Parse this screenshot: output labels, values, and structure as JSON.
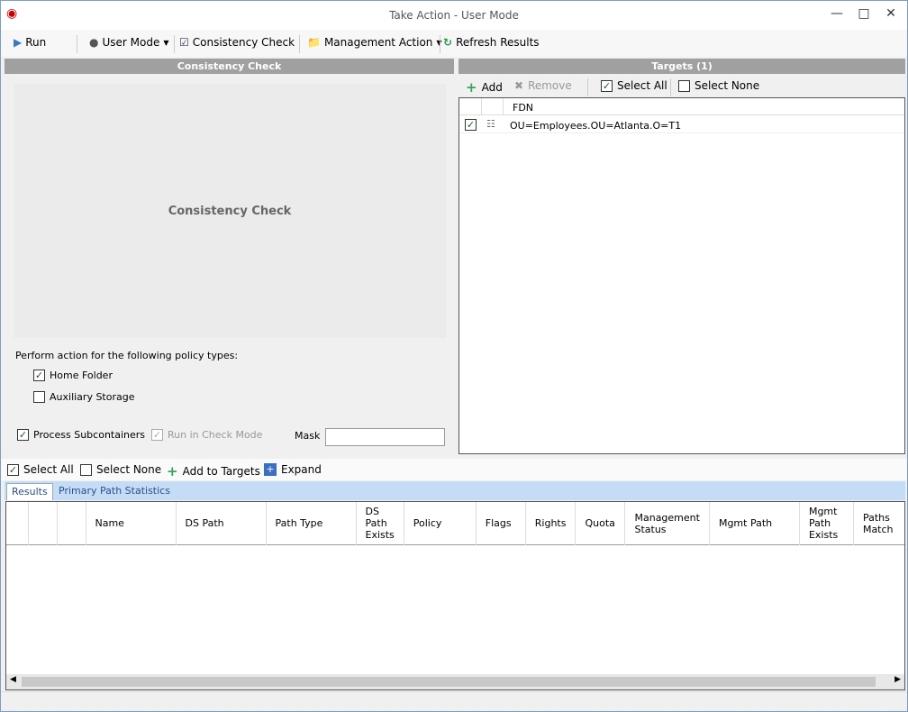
{
  "window": {
    "title": "Take Action - User Mode"
  },
  "toolbar": {
    "run": "Run",
    "user_mode": "User Mode",
    "consistency_check": "Consistency Check",
    "management_action": "Management Action",
    "refresh_results": "Refresh Results"
  },
  "left_panel": {
    "header": "Consistency Check",
    "preview_label": "Consistency Check",
    "policy_prompt": "Perform action for the following policy types:",
    "home_folder": "Home Folder",
    "auxiliary_storage": "Auxiliary Storage",
    "process_subcontainers": "Process Subcontainers",
    "run_in_check_mode": "Run in Check Mode",
    "mask_label": "Mask",
    "mask_value": ""
  },
  "targets": {
    "header": "Targets  (1)",
    "add": "Add",
    "remove": "Remove",
    "select_all": "Select All",
    "select_none": "Select None",
    "column": "FDN",
    "rows": [
      {
        "fdn": "OU=Employees.OU=Atlanta.O=T1",
        "checked": true
      }
    ]
  },
  "results_toolbar": {
    "select_all": "Select All",
    "select_none": "Select None",
    "add_to_targets": "Add to Targets",
    "expand": "Expand"
  },
  "tabs": [
    "Results",
    "Primary Path Statistics"
  ],
  "results_columns": [
    "",
    "",
    "",
    "Name",
    "DS Path",
    "Path Type",
    "DS Path Exists",
    "Policy",
    "Flags",
    "Rights",
    "Quota",
    "Management Status",
    "Mgmt Path",
    "Mgmt Path Exists",
    "Paths Match"
  ]
}
